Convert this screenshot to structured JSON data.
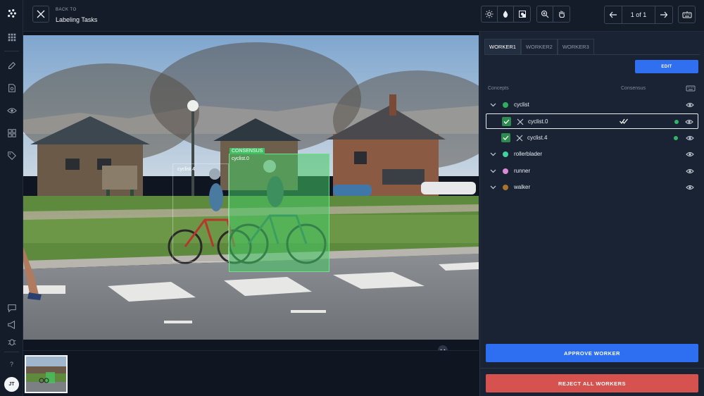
{
  "header": {
    "back_label": "BACK TO",
    "title": "Labeling Tasks",
    "pager_text": "1 of 1"
  },
  "rail": {
    "icons": [
      "logo-icon",
      "grid-icon",
      "edit-icon",
      "document-search-icon",
      "eye-icon",
      "apps-icon",
      "tag-icon",
      "chat-icon",
      "megaphone-icon",
      "bug-icon",
      "help-icon"
    ],
    "help_text": "?",
    "avatar_initials": "JT"
  },
  "canvas": {
    "boxes": [
      {
        "label": "cyclist.4",
        "badge": ""
      },
      {
        "label": "cyclist.0",
        "badge": "CONSENSUS"
      }
    ]
  },
  "panel": {
    "tabs": [
      {
        "label": "WORKER1",
        "active": true
      },
      {
        "label": "WORKER2",
        "active": false
      },
      {
        "label": "WORKER3",
        "active": false
      }
    ],
    "edit_label": "EDIT",
    "concepts_header": "Concepts",
    "consensus_header": "Consensus",
    "concepts": [
      {
        "name": "cyclist",
        "color": "#2fae60"
      },
      {
        "name": "rollerblader",
        "color": "#3fd3a0"
      },
      {
        "name": "runner",
        "color": "#d98ad9"
      },
      {
        "name": "walker",
        "color": "#a8742c"
      }
    ],
    "instances": [
      {
        "name": "cyclist.0",
        "selected": true,
        "consensus": true
      },
      {
        "name": "cyclist.4",
        "selected": false,
        "consensus": false
      }
    ],
    "approve_label": "APPROVE WORKER",
    "reject_label": "REJECT ALL WORKERS"
  },
  "colors": {
    "accent": "#2e6ff2",
    "danger": "#d5524f",
    "annotation": "#3fbf62"
  }
}
